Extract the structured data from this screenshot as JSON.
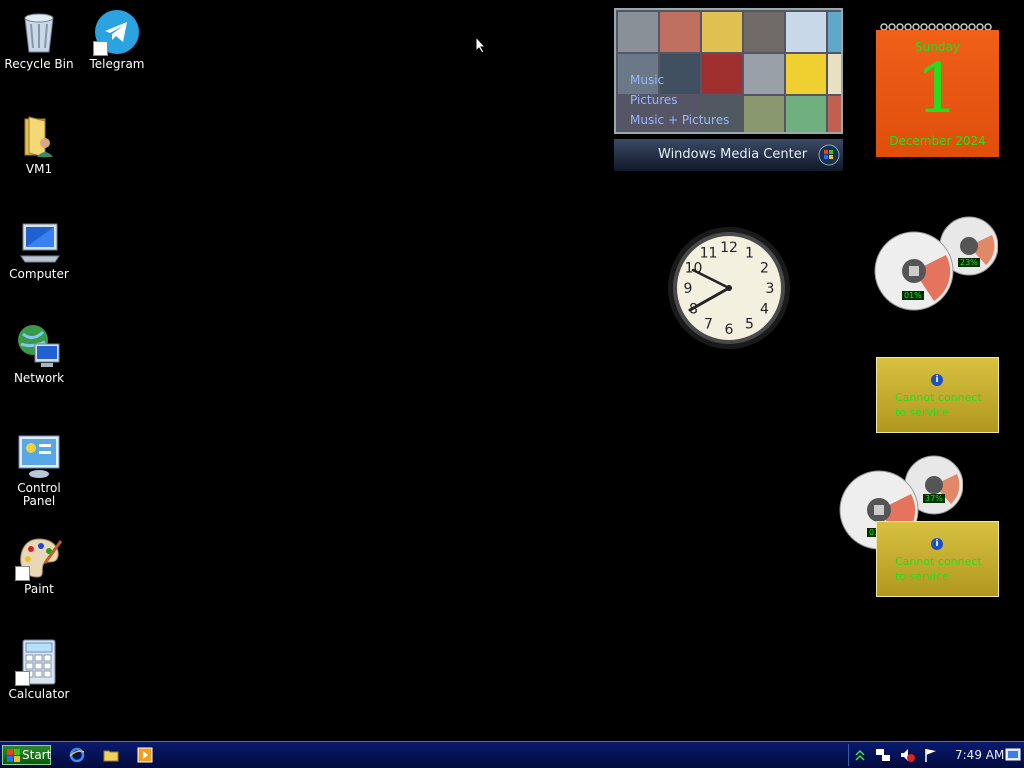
{
  "desktop": {
    "icons": [
      {
        "label": "Recycle Bin"
      },
      {
        "label": "Telegram"
      },
      {
        "label": "VM1"
      },
      {
        "label": "Computer"
      },
      {
        "label": "Network"
      },
      {
        "label": "Control Panel"
      },
      {
        "label": "Paint"
      },
      {
        "label": "Calculator"
      }
    ]
  },
  "media_center": {
    "menu": [
      "Music",
      "Pictures",
      "Music + Pictures"
    ],
    "title": "Windows Media Center"
  },
  "calendar": {
    "weekday": "Sunday",
    "day": "1",
    "month_year": "December 2024"
  },
  "cpu_meter_1": {
    "cpu": "01%",
    "memory": "23%"
  },
  "cpu_meter_2": {
    "cpu": "01%",
    "memory": "37%"
  },
  "weather_1": {
    "line1": "Cannot connect",
    "line2": "to service"
  },
  "weather_2": {
    "line1": "Cannot connect",
    "line2": "to service"
  },
  "clock_gadget": {
    "numerals": [
      "12",
      "1",
      "2",
      "3",
      "4",
      "5",
      "6",
      "7",
      "8",
      "9",
      "10",
      "11"
    ]
  },
  "taskbar": {
    "start_label": "Start",
    "time": "7:49 AM"
  },
  "colors": {
    "accent_green": "#20e020",
    "calendar_orange": "#e85810",
    "taskbar_blue": "#0a1a6e"
  }
}
